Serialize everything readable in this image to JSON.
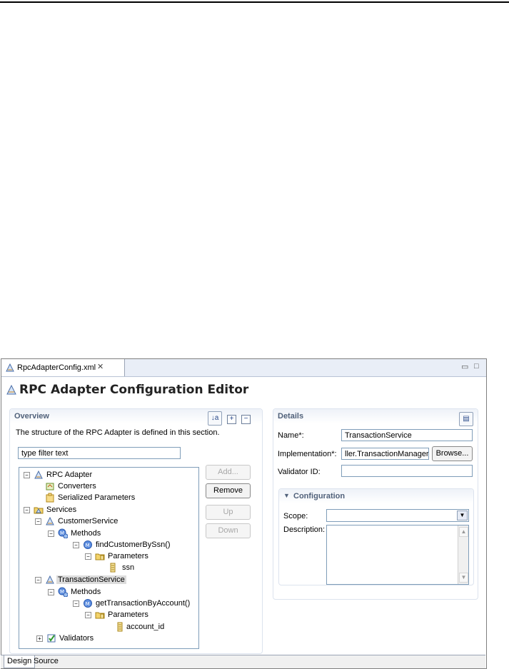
{
  "editor_tab": {
    "label": "RpcAdapterConfig.xml"
  },
  "editor": {
    "title": "RPC Adapter Configuration Editor"
  },
  "overview": {
    "title": "Overview",
    "description": "The structure of the RPC Adapter is defined in this section.",
    "filter_value": "type filter text"
  },
  "tree": [
    {
      "label": "RPC Adapter",
      "toggle": "−",
      "icon": "rpc-adapter-icon"
    },
    {
      "label": "Converters",
      "toggle": "",
      "icon": "converters-icon"
    },
    {
      "label": "Serialized Parameters",
      "toggle": "",
      "icon": "serialized-parameters-icon"
    },
    {
      "label": "Services",
      "toggle": "−",
      "icon": "services-folder-icon"
    },
    {
      "label": "CustomerService",
      "toggle": "−",
      "icon": "service-icon"
    },
    {
      "label": "Methods",
      "toggle": "−",
      "icon": "methods-icon"
    },
    {
      "label": "findCustomerBySsn()",
      "toggle": "−",
      "icon": "method-icon"
    },
    {
      "label": "Parameters",
      "toggle": "−",
      "icon": "parameters-folder-icon"
    },
    {
      "label": "ssn",
      "toggle": "",
      "icon": "parameter-icon"
    },
    {
      "label": "TransactionService",
      "toggle": "−",
      "icon": "service-icon"
    },
    {
      "label": "Methods",
      "toggle": "−",
      "icon": "methods-icon"
    },
    {
      "label": "getTransactionByAccount()",
      "toggle": "−",
      "icon": "method-icon"
    },
    {
      "label": "Parameters",
      "toggle": "−",
      "icon": "parameters-folder-icon"
    },
    {
      "label": "account_id",
      "toggle": "",
      "icon": "parameter-icon"
    },
    {
      "label": "Validators",
      "toggle": "+",
      "icon": "validators-icon"
    }
  ],
  "actions": {
    "add": "Add...",
    "remove": "Remove",
    "up": "Up",
    "down": "Down"
  },
  "details": {
    "title": "Details",
    "name_label": "Name*:",
    "name_value": "TransactionService",
    "impl_label": "Implementation*:",
    "impl_value": "ller.TransactionManager",
    "browse": "Browse...",
    "validator_label": "Validator ID:",
    "validator_value": ""
  },
  "configuration": {
    "title": "Configuration",
    "scope_label": "Scope:",
    "scope_value": "",
    "description_label": "Description:",
    "description_value": ""
  },
  "bottom_tabs": {
    "design": "Design",
    "source": "Source"
  },
  "colors": {
    "section_title": "#50617a",
    "selection": "#dcdcdc",
    "input_border": "#7f9db9"
  }
}
